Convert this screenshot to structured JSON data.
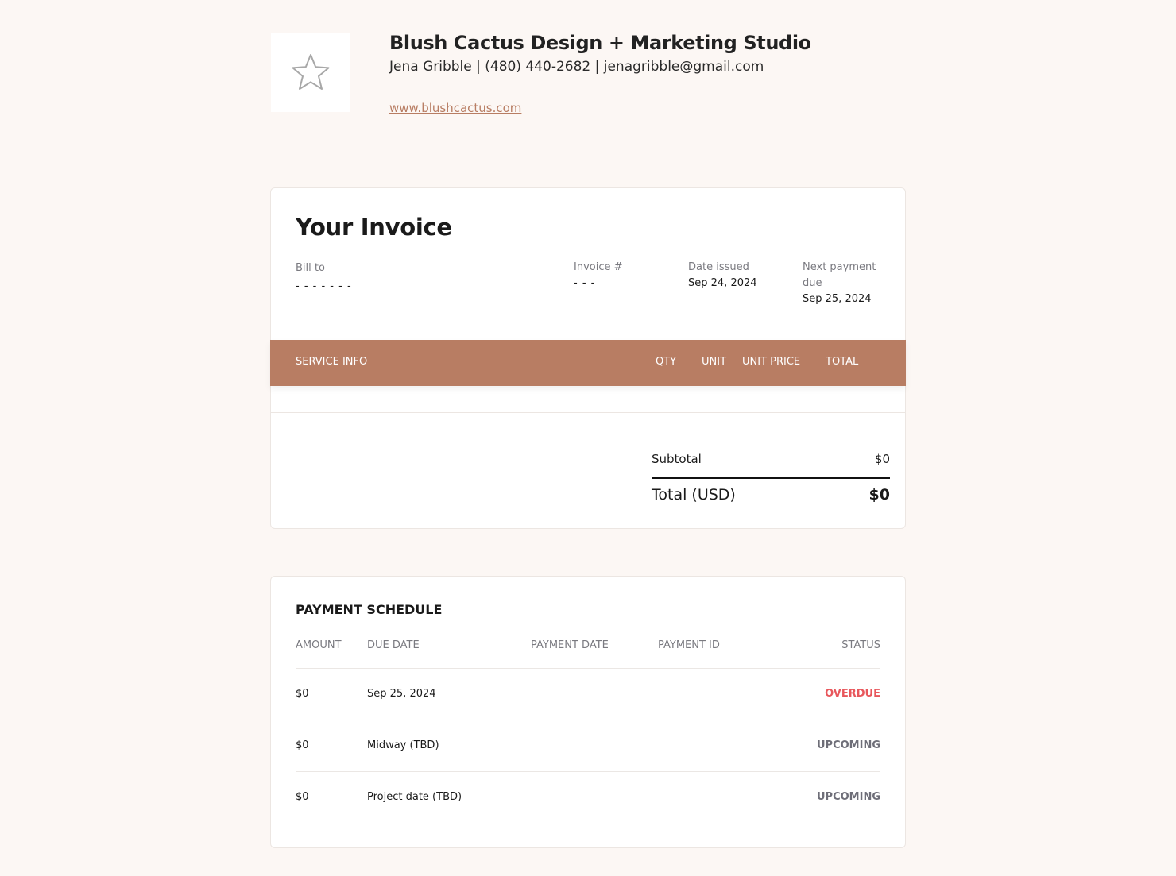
{
  "header": {
    "logo_icon": "star-icon",
    "studio_name": "Blush Cactus Design + Marketing Studio",
    "contact_line": "Jena Gribble | (480) 440-2682 | jenagribble@gmail.com",
    "website": "www.blushcactus.com"
  },
  "invoice": {
    "title": "Your Invoice",
    "bill_to_label": "Bill to",
    "bill_to_value": "- - - - - - -",
    "invoice_number_label": "Invoice #",
    "invoice_number_value": "- - -",
    "date_issued_label": "Date issued",
    "date_issued_value": "Sep 24, 2024",
    "next_payment_label_line1": "Next payment",
    "next_payment_label_line2": "due",
    "next_payment_value": "Sep 25, 2024",
    "columns": {
      "service_info": "SERVICE INFO",
      "qty": "QTY",
      "unit": "UNIT",
      "unit_price": "UNIT PRICE",
      "total": "TOTAL"
    },
    "accent_color": "#b87d63",
    "subtotal_label": "Subtotal",
    "subtotal_value": "$0",
    "total_label": "Total (USD)",
    "total_value": "$0"
  },
  "schedule": {
    "title": "PAYMENT SCHEDULE",
    "columns": {
      "amount": "AMOUNT",
      "due_date": "DUE DATE",
      "payment_date": "PAYMENT DATE",
      "payment_id": "PAYMENT ID",
      "status": "STATUS"
    },
    "rows": [
      {
        "amount": "$0",
        "due_date": "Sep 25, 2024",
        "payment_date": "",
        "payment_id": "",
        "status": "OVERDUE",
        "status_color": "#e8575c"
      },
      {
        "amount": "$0",
        "due_date": "Midway (TBD)",
        "payment_date": "",
        "payment_id": "",
        "status": "UPCOMING",
        "status_color": "#6e6e78"
      },
      {
        "amount": "$0",
        "due_date": "Project date (TBD)",
        "payment_date": "",
        "payment_id": "",
        "status": "UPCOMING",
        "status_color": "#6e6e78"
      }
    ]
  }
}
